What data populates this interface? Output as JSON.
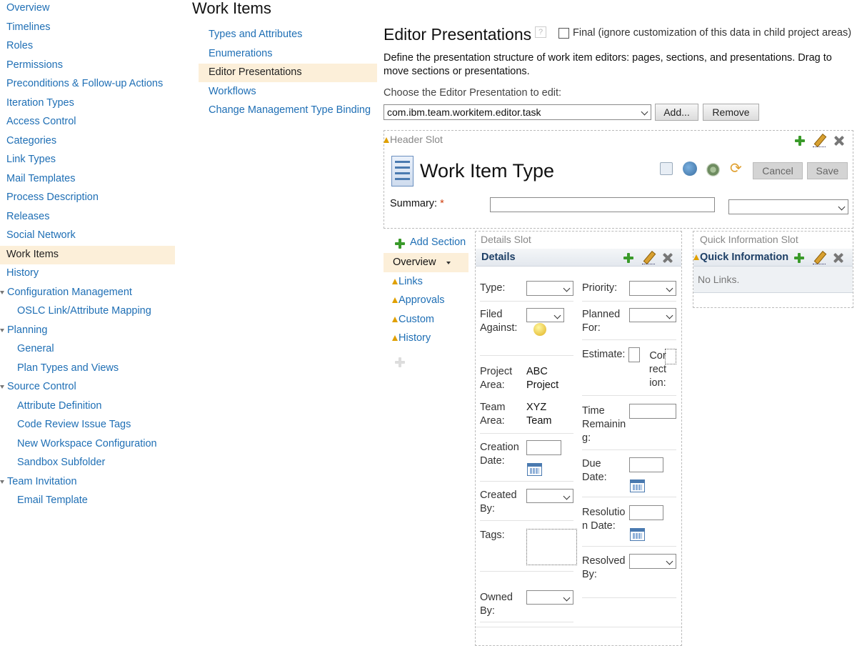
{
  "left_nav": {
    "items": [
      {
        "label": "Overview"
      },
      {
        "label": "Timelines"
      },
      {
        "label": "Roles"
      },
      {
        "label": "Permissions"
      },
      {
        "label": "Preconditions & Follow-up Actions"
      },
      {
        "label": "Iteration Types"
      },
      {
        "label": "Access Control"
      },
      {
        "label": "Categories"
      },
      {
        "label": "Link Types"
      },
      {
        "label": "Mail Templates"
      },
      {
        "label": "Process Description"
      },
      {
        "label": "Releases"
      },
      {
        "label": "Social Network"
      },
      {
        "label": "Work Items",
        "selected": true
      },
      {
        "label": "History"
      },
      {
        "label": "Configuration Management",
        "group": true
      },
      {
        "label": "OSLC Link/Attribute Mapping"
      },
      {
        "label": "Planning",
        "group": true
      },
      {
        "label": "General"
      },
      {
        "label": "Plan Types and Views"
      },
      {
        "label": "Source Control",
        "group": true
      },
      {
        "label": "Attribute Definition"
      },
      {
        "label": "Code Review Issue Tags"
      },
      {
        "label": "New Workspace Configuration"
      },
      {
        "label": "Sandbox Subfolder"
      },
      {
        "label": "Team Invitation",
        "group": true
      },
      {
        "label": "Email Template"
      }
    ]
  },
  "page_title": "Work Items",
  "sub_nav": {
    "items": [
      {
        "label": "Types and Attributes"
      },
      {
        "label": "Enumerations"
      },
      {
        "label": "Editor Presentations",
        "selected": true
      },
      {
        "label": "Workflows"
      },
      {
        "label": "Change Management Type Binding"
      }
    ]
  },
  "editor": {
    "heading": "Editor Presentations",
    "final_label": "Final (ignore customization of this data in child project areas)",
    "description": "Define the presentation structure of work item editors: pages, sections, and presentations. Drag to move sections or presentations.",
    "choose_label": "Choose the Editor Presentation to edit:",
    "selected_presentation": "com.ibm.team.workitem.editor.task",
    "add_button": "Add...",
    "remove_button": "Remove"
  },
  "header_slot": {
    "label": "Header Slot",
    "title": "Work Item Type",
    "cancel": "Cancel",
    "save": "Save",
    "summary_label": "Summary:",
    "required_mark": "*"
  },
  "pages": {
    "add_section": "Add Section",
    "items": [
      {
        "label": "Overview",
        "selected": true
      },
      {
        "label": "Links",
        "warn": true
      },
      {
        "label": "Approvals",
        "warn": true
      },
      {
        "label": "Custom",
        "warn": true
      },
      {
        "label": "History",
        "warn": true
      }
    ]
  },
  "details_slot": {
    "label": "Details Slot",
    "section_title": "Details",
    "left": {
      "type": "Type:",
      "filed_against": "Filed\nAgainst:",
      "project_area": "Project\nArea:",
      "project_area_value": "ABC\nProject",
      "team_area": "Team\nArea:",
      "team_area_value": "XYZ\nTeam",
      "creation_date": "Creation\nDate:",
      "created_by": "Created\nBy:",
      "tags": "Tags:",
      "owned_by": "Owned\nBy:"
    },
    "right": {
      "priority": "Priority:",
      "planned_for": "Planned\nFor:",
      "estimate": "Estimate:",
      "correction": "Cor\nrect\nion:",
      "time_remaining": "Time\nRemainin\ng:",
      "due_date": "Due\nDate:",
      "resolution_date": "Resolutio\nn Date:",
      "resolved_by": "Resolved\nBy:"
    }
  },
  "quick_info_slot": {
    "label": "Quick Information Slot",
    "section_title": "Quick Information",
    "empty_text": "No Links."
  },
  "colors": {
    "link": "#1f6fb5",
    "selected_bg": "#fcefd9",
    "section_header": "#1d3f66",
    "add_green": "#3a9a2a",
    "warning": "#e0a000"
  }
}
